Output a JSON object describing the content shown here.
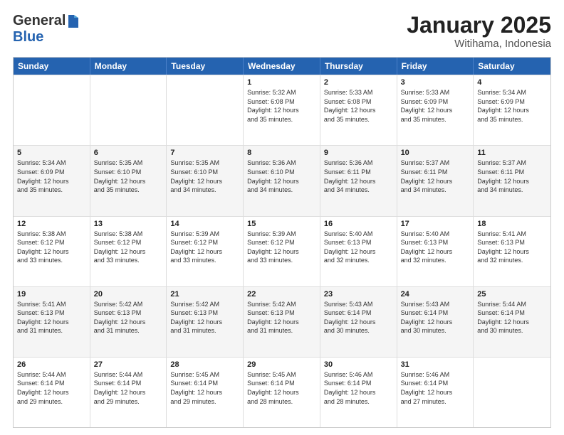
{
  "logo": {
    "general": "General",
    "blue": "Blue"
  },
  "title": {
    "month": "January 2025",
    "location": "Witihama, Indonesia"
  },
  "header": {
    "days": [
      "Sunday",
      "Monday",
      "Tuesday",
      "Wednesday",
      "Thursday",
      "Friday",
      "Saturday"
    ]
  },
  "weeks": [
    {
      "alt": false,
      "cells": [
        {
          "day": "",
          "info": ""
        },
        {
          "day": "",
          "info": ""
        },
        {
          "day": "",
          "info": ""
        },
        {
          "day": "1",
          "info": "Sunrise: 5:32 AM\nSunset: 6:08 PM\nDaylight: 12 hours\nand 35 minutes."
        },
        {
          "day": "2",
          "info": "Sunrise: 5:33 AM\nSunset: 6:08 PM\nDaylight: 12 hours\nand 35 minutes."
        },
        {
          "day": "3",
          "info": "Sunrise: 5:33 AM\nSunset: 6:09 PM\nDaylight: 12 hours\nand 35 minutes."
        },
        {
          "day": "4",
          "info": "Sunrise: 5:34 AM\nSunset: 6:09 PM\nDaylight: 12 hours\nand 35 minutes."
        }
      ]
    },
    {
      "alt": true,
      "cells": [
        {
          "day": "5",
          "info": "Sunrise: 5:34 AM\nSunset: 6:09 PM\nDaylight: 12 hours\nand 35 minutes."
        },
        {
          "day": "6",
          "info": "Sunrise: 5:35 AM\nSunset: 6:10 PM\nDaylight: 12 hours\nand 35 minutes."
        },
        {
          "day": "7",
          "info": "Sunrise: 5:35 AM\nSunset: 6:10 PM\nDaylight: 12 hours\nand 34 minutes."
        },
        {
          "day": "8",
          "info": "Sunrise: 5:36 AM\nSunset: 6:10 PM\nDaylight: 12 hours\nand 34 minutes."
        },
        {
          "day": "9",
          "info": "Sunrise: 5:36 AM\nSunset: 6:11 PM\nDaylight: 12 hours\nand 34 minutes."
        },
        {
          "day": "10",
          "info": "Sunrise: 5:37 AM\nSunset: 6:11 PM\nDaylight: 12 hours\nand 34 minutes."
        },
        {
          "day": "11",
          "info": "Sunrise: 5:37 AM\nSunset: 6:11 PM\nDaylight: 12 hours\nand 34 minutes."
        }
      ]
    },
    {
      "alt": false,
      "cells": [
        {
          "day": "12",
          "info": "Sunrise: 5:38 AM\nSunset: 6:12 PM\nDaylight: 12 hours\nand 33 minutes."
        },
        {
          "day": "13",
          "info": "Sunrise: 5:38 AM\nSunset: 6:12 PM\nDaylight: 12 hours\nand 33 minutes."
        },
        {
          "day": "14",
          "info": "Sunrise: 5:39 AM\nSunset: 6:12 PM\nDaylight: 12 hours\nand 33 minutes."
        },
        {
          "day": "15",
          "info": "Sunrise: 5:39 AM\nSunset: 6:12 PM\nDaylight: 12 hours\nand 33 minutes."
        },
        {
          "day": "16",
          "info": "Sunrise: 5:40 AM\nSunset: 6:13 PM\nDaylight: 12 hours\nand 32 minutes."
        },
        {
          "day": "17",
          "info": "Sunrise: 5:40 AM\nSunset: 6:13 PM\nDaylight: 12 hours\nand 32 minutes."
        },
        {
          "day": "18",
          "info": "Sunrise: 5:41 AM\nSunset: 6:13 PM\nDaylight: 12 hours\nand 32 minutes."
        }
      ]
    },
    {
      "alt": true,
      "cells": [
        {
          "day": "19",
          "info": "Sunrise: 5:41 AM\nSunset: 6:13 PM\nDaylight: 12 hours\nand 31 minutes."
        },
        {
          "day": "20",
          "info": "Sunrise: 5:42 AM\nSunset: 6:13 PM\nDaylight: 12 hours\nand 31 minutes."
        },
        {
          "day": "21",
          "info": "Sunrise: 5:42 AM\nSunset: 6:13 PM\nDaylight: 12 hours\nand 31 minutes."
        },
        {
          "day": "22",
          "info": "Sunrise: 5:42 AM\nSunset: 6:13 PM\nDaylight: 12 hours\nand 31 minutes."
        },
        {
          "day": "23",
          "info": "Sunrise: 5:43 AM\nSunset: 6:14 PM\nDaylight: 12 hours\nand 30 minutes."
        },
        {
          "day": "24",
          "info": "Sunrise: 5:43 AM\nSunset: 6:14 PM\nDaylight: 12 hours\nand 30 minutes."
        },
        {
          "day": "25",
          "info": "Sunrise: 5:44 AM\nSunset: 6:14 PM\nDaylight: 12 hours\nand 30 minutes."
        }
      ]
    },
    {
      "alt": false,
      "cells": [
        {
          "day": "26",
          "info": "Sunrise: 5:44 AM\nSunset: 6:14 PM\nDaylight: 12 hours\nand 29 minutes."
        },
        {
          "day": "27",
          "info": "Sunrise: 5:44 AM\nSunset: 6:14 PM\nDaylight: 12 hours\nand 29 minutes."
        },
        {
          "day": "28",
          "info": "Sunrise: 5:45 AM\nSunset: 6:14 PM\nDaylight: 12 hours\nand 29 minutes."
        },
        {
          "day": "29",
          "info": "Sunrise: 5:45 AM\nSunset: 6:14 PM\nDaylight: 12 hours\nand 28 minutes."
        },
        {
          "day": "30",
          "info": "Sunrise: 5:46 AM\nSunset: 6:14 PM\nDaylight: 12 hours\nand 28 minutes."
        },
        {
          "day": "31",
          "info": "Sunrise: 5:46 AM\nSunset: 6:14 PM\nDaylight: 12 hours\nand 27 minutes."
        },
        {
          "day": "",
          "info": ""
        }
      ]
    }
  ]
}
